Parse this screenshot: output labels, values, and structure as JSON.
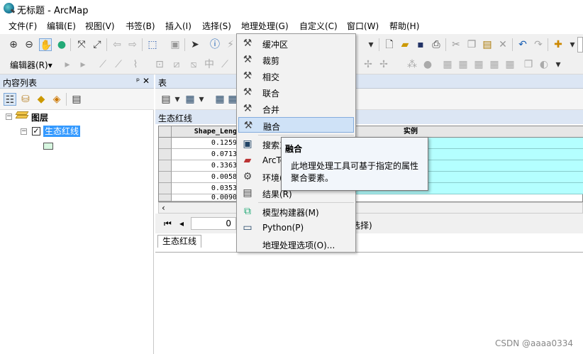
{
  "window": {
    "title": "无标题 - ArcMap"
  },
  "menubar": [
    "文件(F)",
    "编辑(E)",
    "视图(V)",
    "书签(B)",
    "插入(I)",
    "选择(S)",
    "地理处理(G)",
    "自定义(C)",
    "窗口(W)",
    "帮助(H)"
  ],
  "toolbar": {
    "editor_label": "编辑器(R)▾"
  },
  "toc": {
    "title": "内容列表",
    "pin": "ᵖ ✕",
    "root_label": "图层",
    "layer_label": "生态红线"
  },
  "table": {
    "window_title": "表",
    "close": "✕",
    "table_name": "生态红线",
    "columns": [
      "Shape_Leng",
      "实例"
    ],
    "rows": [
      "0.1259",
      "0.0713",
      "0.3363",
      "0.0058",
      "0.0353",
      "0.0090"
    ],
    "record_nav": {
      "current": "0",
      "selection_text": "选择)"
    },
    "tab_label": "生态红线"
  },
  "geoprocessing_menu": {
    "items": [
      "缓冲区",
      "裁剪",
      "相交",
      "联合",
      "合并",
      "融合",
      "搜索工",
      "ArcTo",
      "环境(",
      "结果(R)",
      "模型构建器(M)",
      "Python(P)",
      "地理处理选项(O)..."
    ],
    "highlighted": "融合"
  },
  "tooltip": {
    "title": "融合",
    "body": "此地理处理工具可基于指定的属性聚合要素。"
  },
  "watermark": "CSDN @aaaa0334",
  "colors": {
    "highlight": "#3399ff",
    "menu_hover": "#cfe2f7",
    "table_cyan": "#b4ffff",
    "panel_header": "#dce6f4"
  }
}
